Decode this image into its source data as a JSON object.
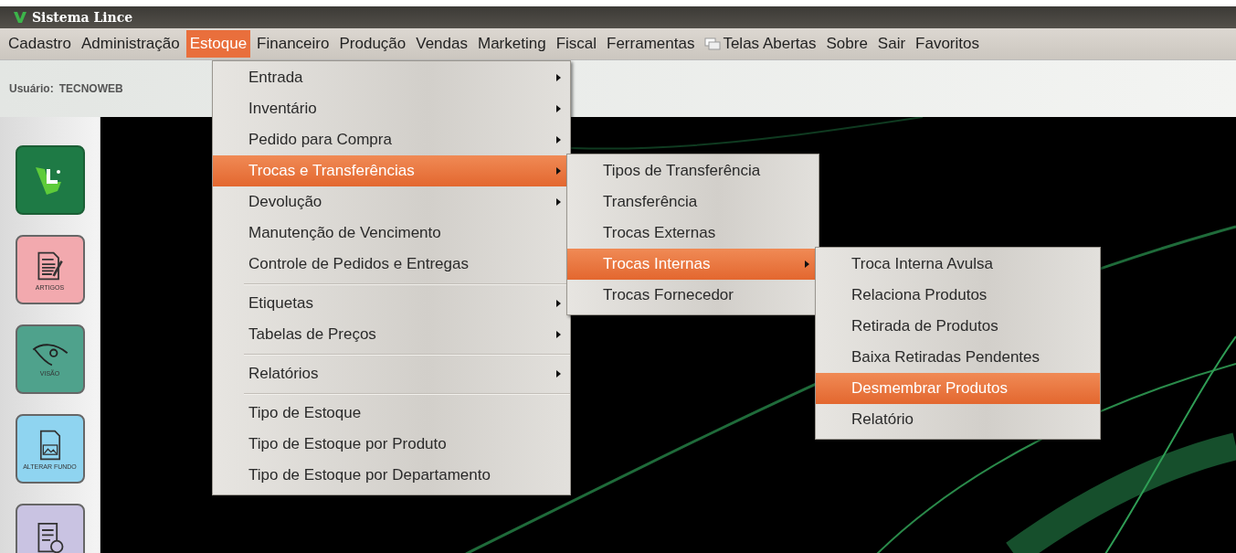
{
  "window": {
    "title": "Sistema Lince"
  },
  "menubar": [
    {
      "label": "Cadastro",
      "selected": false,
      "has_icon": false
    },
    {
      "label": "Administração",
      "selected": false,
      "has_icon": false
    },
    {
      "label": "Estoque",
      "selected": true,
      "has_icon": false
    },
    {
      "label": "Financeiro",
      "selected": false,
      "has_icon": false
    },
    {
      "label": "Produção",
      "selected": false,
      "has_icon": false
    },
    {
      "label": "Vendas",
      "selected": false,
      "has_icon": false
    },
    {
      "label": "Marketing",
      "selected": false,
      "has_icon": false
    },
    {
      "label": "Fiscal",
      "selected": false,
      "has_icon": false
    },
    {
      "label": "Ferramentas",
      "selected": false,
      "has_icon": false
    },
    {
      "label": "Telas Abertas",
      "selected": false,
      "has_icon": true
    },
    {
      "label": "Sobre",
      "selected": false,
      "has_icon": false
    },
    {
      "label": "Sair",
      "selected": false,
      "has_icon": false
    },
    {
      "label": "Favoritos",
      "selected": false,
      "has_icon": false
    }
  ],
  "header": {
    "user_label": "Usuário:",
    "user_name": "TECNOWEB"
  },
  "sidebar": [
    {
      "kind": "logo",
      "color": "#1e7a45"
    },
    {
      "kind": "document",
      "label": "ARTIGOS",
      "color": "#f2a9ae"
    },
    {
      "kind": "eye",
      "label": "VISÃO",
      "color": "#4fa28c"
    },
    {
      "kind": "picture",
      "label": "ALTERAR FUNDO",
      "color": "#8fd4f0"
    },
    {
      "kind": "report",
      "color": "#c9c3e2"
    }
  ],
  "open_menus": [
    {
      "items": [
        {
          "kind": "item",
          "label": "Entrada",
          "submenu": true,
          "selected": false
        },
        {
          "kind": "item",
          "label": "Inventário",
          "submenu": true,
          "selected": false
        },
        {
          "kind": "item",
          "label": "Pedido para Compra",
          "submenu": true,
          "selected": false
        },
        {
          "kind": "item",
          "label": "Trocas e Transferências",
          "submenu": true,
          "selected": true
        },
        {
          "kind": "item",
          "label": "Devolução",
          "submenu": true,
          "selected": false
        },
        {
          "kind": "item",
          "label": "Manutenção de Vencimento",
          "submenu": false,
          "selected": false
        },
        {
          "kind": "item",
          "label": "Controle de Pedidos e Entregas",
          "submenu": false,
          "selected": false
        },
        {
          "kind": "separator"
        },
        {
          "kind": "item",
          "label": "Etiquetas",
          "submenu": true,
          "selected": false
        },
        {
          "kind": "item",
          "label": "Tabelas de Preços",
          "submenu": true,
          "selected": false
        },
        {
          "kind": "separator"
        },
        {
          "kind": "item",
          "label": "Relatórios",
          "submenu": true,
          "selected": false
        },
        {
          "kind": "separator"
        },
        {
          "kind": "item",
          "label": "Tipo de Estoque",
          "submenu": false,
          "selected": false
        },
        {
          "kind": "item",
          "label": "Tipo de Estoque por Produto",
          "submenu": false,
          "selected": false
        },
        {
          "kind": "item",
          "label": "Tipo de Estoque por Departamento",
          "submenu": false,
          "selected": false
        }
      ]
    },
    {
      "items": [
        {
          "kind": "item",
          "label": "Tipos de Transferência",
          "submenu": false,
          "selected": false
        },
        {
          "kind": "item",
          "label": "Transferência",
          "submenu": false,
          "selected": false
        },
        {
          "kind": "item",
          "label": "Trocas Externas",
          "submenu": false,
          "selected": false
        },
        {
          "kind": "item",
          "label": "Trocas Internas",
          "submenu": true,
          "selected": true
        },
        {
          "kind": "item",
          "label": "Trocas Fornecedor",
          "submenu": false,
          "selected": false
        }
      ]
    },
    {
      "items": [
        {
          "kind": "item",
          "label": "Troca Interna Avulsa",
          "submenu": false,
          "selected": false
        },
        {
          "kind": "item",
          "label": "Relaciona Produtos",
          "submenu": false,
          "selected": false
        },
        {
          "kind": "item",
          "label": "Retirada de Produtos",
          "submenu": false,
          "selected": false
        },
        {
          "kind": "item",
          "label": "Baixa Retiradas Pendentes",
          "submenu": false,
          "selected": false
        },
        {
          "kind": "item",
          "label": "Desmembrar Produtos",
          "submenu": false,
          "selected": true
        },
        {
          "kind": "item",
          "label": "Relatório",
          "submenu": false,
          "selected": false
        }
      ]
    }
  ]
}
